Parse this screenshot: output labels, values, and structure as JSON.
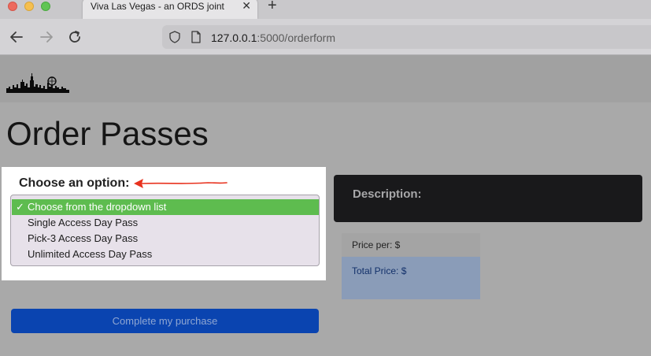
{
  "browser": {
    "tab_title": "Viva Las Vegas - an ORDS joint",
    "tab_close": "✕",
    "new_tab": "+",
    "url_host": "127.0.0.1",
    "url_rest": ":5000/orderform",
    "icons": [
      "back-arrow-icon",
      "forward-arrow-icon",
      "reload-icon",
      "shield-icon",
      "page-icon"
    ]
  },
  "page": {
    "title": "Order Passes",
    "choose_label": "Choose an option:",
    "select": {
      "check_mark": "✓",
      "options": [
        "Choose from the dropdown list",
        "Single Access Day Pass",
        "Pick-3 Access Day Pass",
        "Unlimited Access Day Pass"
      ],
      "selected_index": 0
    },
    "description_label": "Description:",
    "price_per_label": "Price per: $",
    "total_price_label": "Total Price: $",
    "purchase_button": "Complete my purchase"
  },
  "colors": {
    "selected_option": "#5ebc4f",
    "annotation_arrow": "#e8321e",
    "purchase_button": "#0a44b0",
    "description_bg": "#19191b"
  }
}
